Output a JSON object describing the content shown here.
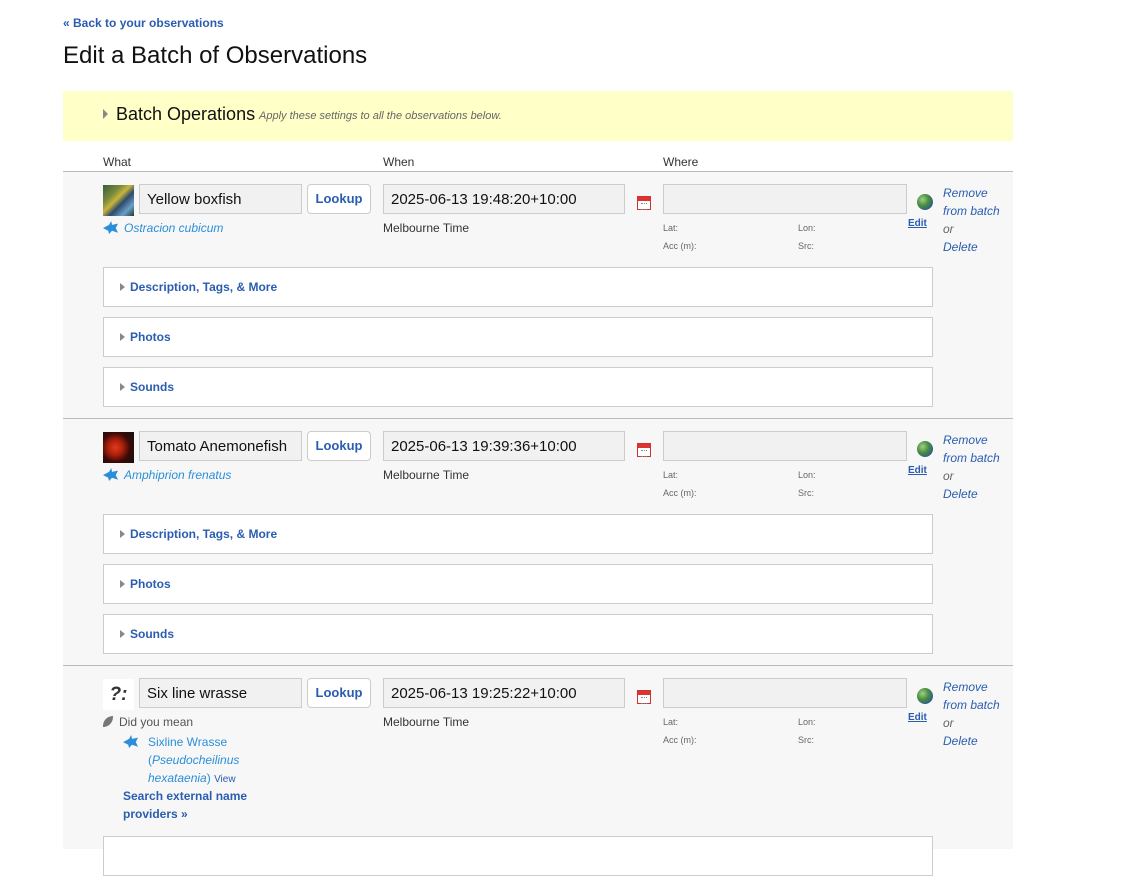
{
  "back_link": "« Back to your observations",
  "page_title": "Edit a Batch of Observations",
  "batch_ops": {
    "label": "Batch Operations",
    "hint": "Apply these settings to all the observations below."
  },
  "columns": {
    "what": "What",
    "when": "When",
    "where": "Where"
  },
  "labels": {
    "lookup": "Lookup",
    "timezone": "Melbourne Time",
    "lat": "Lat:",
    "lon": "Lon:",
    "acc": "Acc (m):",
    "src": "Src:",
    "edit": "Edit",
    "remove": "Remove from batch",
    "or": "or",
    "delete": "Delete",
    "desc_section": "Description, Tags, & More",
    "photos_section": "Photos",
    "sounds_section": "Sounds",
    "did_you_mean": "Did you mean",
    "view": "View",
    "search_external": "Search external name providers »"
  },
  "observations": [
    {
      "name": "Yellow boxfish",
      "taxon": "Ostracion cubicum",
      "datetime": "2025-06-13 19:48:20+10:00",
      "place": ""
    },
    {
      "name": "Tomato Anemonefish",
      "taxon": "Amphiprion frenatus",
      "datetime": "2025-06-13 19:39:36+10:00",
      "place": ""
    },
    {
      "name": "Six line wrasse",
      "datetime": "2025-06-13 19:25:22+10:00",
      "place": "",
      "suggestion": {
        "common": "Sixline Wrasse",
        "scientific": "Pseudocheilinus hexataenia"
      }
    }
  ],
  "unknown_glyph": "?:"
}
